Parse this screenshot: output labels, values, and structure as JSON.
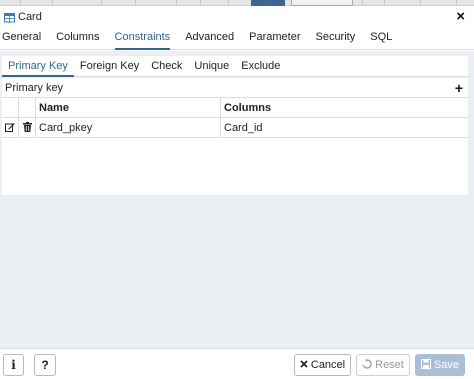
{
  "dialog": {
    "title": "Card",
    "close_glyph": "×"
  },
  "tabs": [
    {
      "label": "General"
    },
    {
      "label": "Columns"
    },
    {
      "label": "Constraints",
      "active": true
    },
    {
      "label": "Advanced"
    },
    {
      "label": "Parameter"
    },
    {
      "label": "Security"
    },
    {
      "label": "SQL"
    }
  ],
  "subtabs": [
    {
      "label": "Primary Key",
      "active": true
    },
    {
      "label": "Foreign Key"
    },
    {
      "label": "Check"
    },
    {
      "label": "Unique"
    },
    {
      "label": "Exclude"
    }
  ],
  "panel": {
    "title": "Primary key",
    "add_glyph": "+",
    "columns": [
      "Name",
      "Columns"
    ],
    "rows": [
      {
        "name": "Card_pkey",
        "columns": "Card_id"
      }
    ]
  },
  "footer": {
    "info_glyph": "i",
    "help_glyph": "?",
    "cancel_label": "Cancel",
    "reset_label": "Reset",
    "save_label": "Save"
  },
  "colors": {
    "accent": "#326690",
    "content_bg": "#ebeef3",
    "save_bg": "#a9bfd6"
  }
}
